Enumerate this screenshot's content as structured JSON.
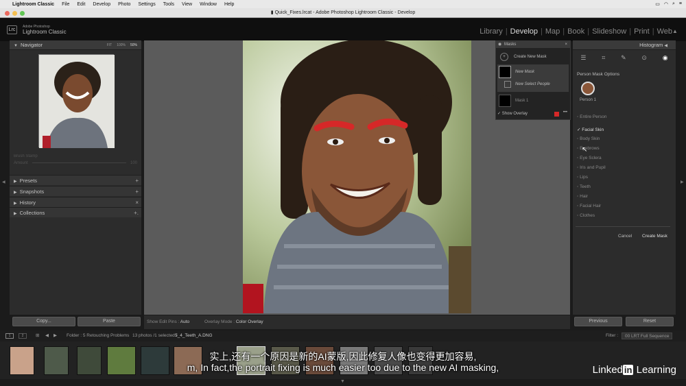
{
  "menubar": {
    "app": "Lightroom Classic",
    "items": [
      "File",
      "Edit",
      "Develop",
      "Photo",
      "Settings",
      "Tools",
      "View",
      "Window",
      "Help"
    ]
  },
  "titlebar": {
    "title": "Quick_Fixes.lrcat - Adobe Photoshop Lightroom Classic - Develop"
  },
  "identity": {
    "logo": "Lrc",
    "brand_small": "Adobe Photoshop",
    "brand_name": "Lightroom Classic"
  },
  "modules": [
    "Library",
    "Develop",
    "Map",
    "Book",
    "Slideshow",
    "Print",
    "Web"
  ],
  "active_module": "Develop",
  "left": {
    "navigator": {
      "title": "Navigator",
      "zoom": [
        "FIT",
        "100%",
        "50%"
      ]
    },
    "faded_panel": {
      "label": "Brush Stamp",
      "value": "Amount",
      "num": "100"
    },
    "sections": [
      {
        "label": "Presets",
        "ctl": "+"
      },
      {
        "label": "Snapshots",
        "ctl": "+"
      },
      {
        "label": "History",
        "ctl": "×"
      },
      {
        "label": "Collections",
        "ctl": "+."
      }
    ],
    "copy_label": "Copy...",
    "paste_label": "Paste"
  },
  "masks": {
    "title": "Masks",
    "create_new": "Create New Mask",
    "items": [
      "New Mask",
      "New Select People",
      "Mask 1"
    ],
    "show_overlay": "Show Overlay"
  },
  "right": {
    "histogram": "Histogram",
    "person_mask_options": "Person Mask Options",
    "person_label": "Person 1",
    "options": [
      {
        "label": "Entire Person",
        "checked": false
      },
      {
        "label": "Facial Skin",
        "checked": true
      },
      {
        "label": "Body Skin",
        "checked": false
      },
      {
        "label": "Eyebrows",
        "checked": false
      },
      {
        "label": "Eye Sclera",
        "checked": false
      },
      {
        "label": "Iris and Pupil",
        "checked": false
      },
      {
        "label": "Lips",
        "checked": false
      },
      {
        "label": "Teeth",
        "checked": false
      },
      {
        "label": "Hair",
        "checked": false
      },
      {
        "label": "Facial Hair",
        "checked": false
      },
      {
        "label": "Clothes",
        "checked": false
      }
    ],
    "cancel": "Cancel",
    "create_mask": "Create Mask",
    "previous": "Previous",
    "reset": "Reset"
  },
  "toolbar": {
    "show_edit_pins_label": "Show Edit Pins :",
    "show_edit_pins_value": "Auto",
    "overlay_mode_label": "Overlay Mode :",
    "overlay_mode_value": "Color Overlay"
  },
  "filmstrip": {
    "folder": "Folder : 5 Retouching Problems",
    "count": "13 photos /1 selected /",
    "selected_file": "5_4_Teeth_A.DNG",
    "filter_label": "Filter :",
    "filter_value": "00 LRT Full Sequence",
    "pages": [
      "1",
      "2"
    ]
  },
  "subtitles": {
    "zh": "实上,还有一个原因是新的AI蒙版,因此修复人像也变得更加容易,",
    "en": "m, In fact,the portrait fixing is much easier too due to the new AI masking,"
  },
  "watermark": {
    "pre": "Linked",
    "in": "in",
    "post": " Learning"
  },
  "colors": {
    "accent_mask_red": "#d62828",
    "panel_bg": "#2c2c2c"
  }
}
